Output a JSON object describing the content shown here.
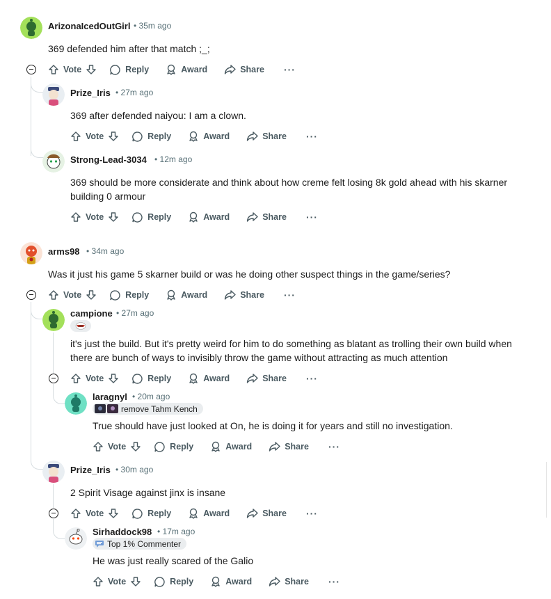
{
  "colors": {
    "snoo_green": "#46d160",
    "snoo_orange": "#ff4500",
    "text_meta": "#576f76",
    "thread_line": "#d7dde0"
  },
  "actions": {
    "vote": "Vote",
    "reply": "Reply",
    "award": "Award",
    "share": "Share",
    "more": "···"
  },
  "comments": [
    {
      "user": "ArizonaIcedOutGirl",
      "time": "35m ago",
      "body": "369 defended him after that match ;_;"
    },
    {
      "user": "Prize_Iris",
      "time": "27m ago",
      "body": "369 after defended naiyou: I am a clown."
    },
    {
      "user": "Strong-Lead-3034",
      "time": "12m ago",
      "body": "369 should be more considerate and think about how creme felt losing 8k gold ahead with his skarner building 0 armour"
    },
    {
      "user": "arms98",
      "time": "34m ago",
      "body": "Was it just his game 5 skarner build or was he doing other suspect things in the game/series?"
    },
    {
      "user": "campione",
      "time": "27m ago",
      "body": "it's just the build. But it's pretty weird for him to do something as blatant as trolling their own build when there are bunch of ways to invisibly throw the game without attracting as much attention"
    },
    {
      "user": "laragnyl",
      "time": "20m ago",
      "flair": "remove Tahm Kench",
      "body": "True should have just looked at On, he is doing it for years and still no investigation."
    },
    {
      "user": "Prize_Iris",
      "time": "30m ago",
      "body": "2 Spirit Visage against jinx is insane"
    },
    {
      "user": "Sirhaddock98",
      "time": "17m ago",
      "flair": "Top 1% Commenter",
      "body": "He was just really scared of the Galio"
    }
  ]
}
